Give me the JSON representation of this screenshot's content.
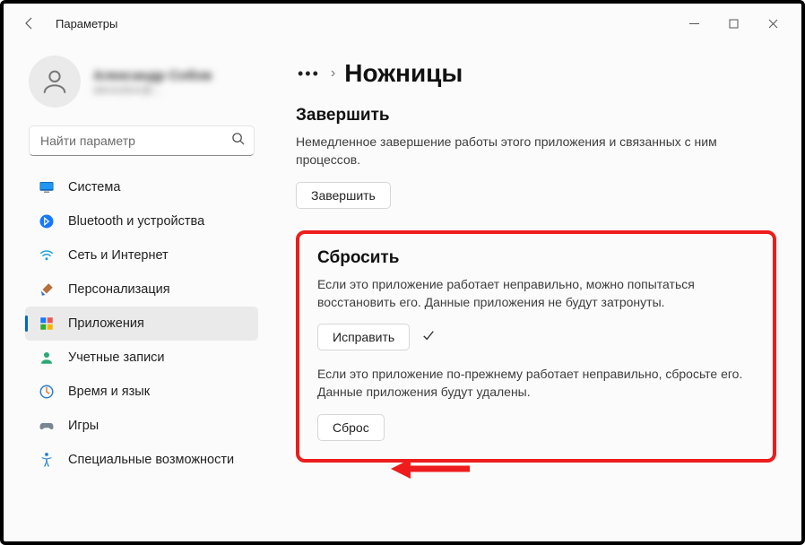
{
  "window": {
    "title": "Параметры"
  },
  "profile": {
    "name": "Александр Собов",
    "email": "alexsobov@..."
  },
  "search": {
    "placeholder": "Найти параметр"
  },
  "sidebar": {
    "items": [
      {
        "label": "Система"
      },
      {
        "label": "Bluetooth и устройства"
      },
      {
        "label": "Сеть и Интернет"
      },
      {
        "label": "Персонализация"
      },
      {
        "label": "Приложения"
      },
      {
        "label": "Учетные записи"
      },
      {
        "label": "Время и язык"
      },
      {
        "label": "Игры"
      },
      {
        "label": "Специальные возможности"
      }
    ]
  },
  "breadcrumb": {
    "title": "Ножницы"
  },
  "terminate": {
    "title": "Завершить",
    "desc": "Немедленное завершение работы этого приложения и связанных с ним процессов.",
    "button": "Завершить"
  },
  "reset": {
    "title": "Сбросить",
    "desc1": "Если это приложение работает неправильно, можно попытаться восстановить его. Данные приложения не будут затронуты.",
    "repair_button": "Исправить",
    "desc2": "Если это приложение по-прежнему работает неправильно, сбросьте его. Данные приложения будут удалены.",
    "reset_button": "Сброс"
  },
  "annotation": {
    "arrow_color": "#ee1c1c"
  }
}
